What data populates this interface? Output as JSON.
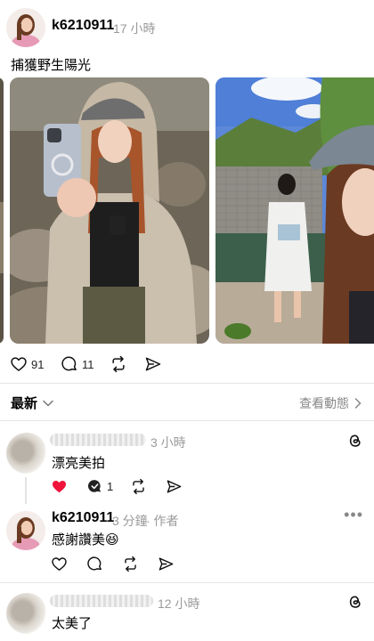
{
  "post": {
    "username": "k6210911",
    "time": "17 小時",
    "caption": "捕獲野生陽光",
    "likes": "91",
    "comments": "11"
  },
  "sort": {
    "label": "最新",
    "activity_link": "查看動態"
  },
  "comments": [
    {
      "time": "3 小時",
      "text": "漂亮美拍",
      "liked": true,
      "reply_count": "1"
    },
    {
      "username": "k6210911",
      "time": "3 分鐘",
      "author_tag": "· 作者",
      "text": "感謝讚美😆"
    },
    {
      "time": "12 小時",
      "text": "太美了"
    }
  ],
  "colors": {
    "like_red": "#f0133a",
    "muted_gray": "#9a9a9a"
  }
}
